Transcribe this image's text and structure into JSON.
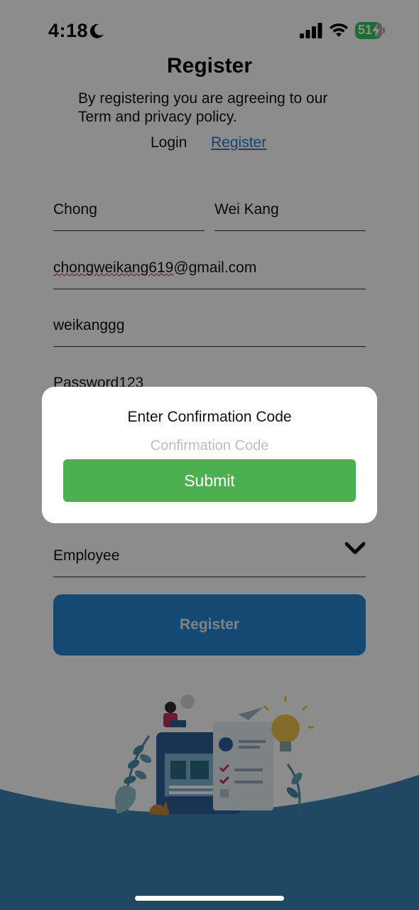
{
  "status_bar": {
    "time": "4:18",
    "battery": "51",
    "icons": [
      "moon-icon",
      "signal-icon",
      "wifi-icon",
      "battery-icon",
      "charging-bolt-icon"
    ]
  },
  "header": {
    "title": "Register",
    "subtitle": "By registering you are agreeing to our Term and privacy policy.",
    "tabs": {
      "login": "Login",
      "register": "Register"
    }
  },
  "form": {
    "first_name": "Chong",
    "last_name": "Wei Kang",
    "email": "chongweikang619@gmail.com",
    "email_local_part": "chongweikang619",
    "email_domain": "@gmail.com",
    "username": "weikanggg",
    "password": "Password123",
    "role": "Employee",
    "register_label": "Register"
  },
  "modal": {
    "title": "Enter Confirmation Code",
    "placeholder": "Confirmation Code",
    "code_value": "",
    "submit_label": "Submit"
  },
  "colors": {
    "accent_blue": "#2385cf",
    "submit_green": "#4caf50",
    "link_blue": "#2f7bbd",
    "wave_blue": "#3d84b5",
    "battery_green": "#34c759"
  }
}
